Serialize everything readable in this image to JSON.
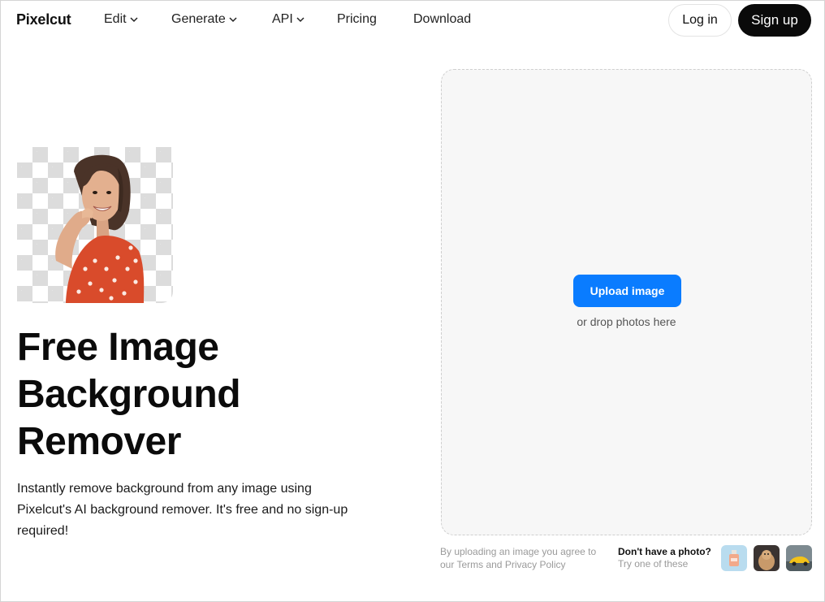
{
  "header": {
    "logo": "Pixelcut",
    "nav": [
      {
        "label": "Edit",
        "has_dropdown": true
      },
      {
        "label": "Generate",
        "has_dropdown": true
      },
      {
        "label": "API",
        "has_dropdown": true
      },
      {
        "label": "Pricing",
        "has_dropdown": false
      },
      {
        "label": "Download",
        "has_dropdown": false
      }
    ],
    "login_label": "Log in",
    "signup_label": "Sign up"
  },
  "hero": {
    "headline": "Free Image Background Remover",
    "subtext": "Instantly remove background from any image using Pixelcut's AI background remover. It's free and no sign-up required!"
  },
  "upload": {
    "button_label": "Upload image",
    "hint": "or drop photos here",
    "terms": "By uploading an image you agree to our Terms and Privacy Policy",
    "no_photo_title": "Don't have a photo?",
    "no_photo_sub": "Try one of these",
    "samples": [
      "perfume-bottle-sample",
      "dog-sample",
      "car-sample"
    ]
  },
  "colors": {
    "accent": "#0a7cff",
    "signup_bg": "#0a0a0a",
    "drop_zone_bg": "#f7f7f7"
  }
}
